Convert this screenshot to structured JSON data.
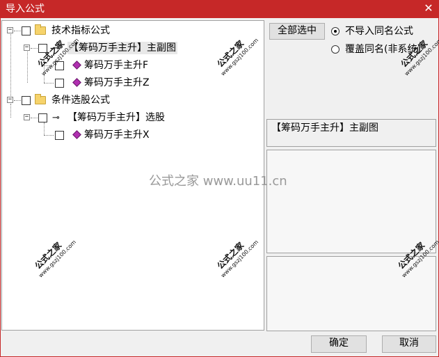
{
  "window": {
    "title": "导入公式",
    "close_glyph": "✕"
  },
  "tree": {
    "groups": [
      {
        "label": "技术指标公式",
        "expander": "−",
        "children": [
          {
            "label": "【筹码万手主升】主副图",
            "expander": "−",
            "children": [
              {
                "label": "筹码万手主升F"
              },
              {
                "label": "筹码万手主升Z"
              }
            ]
          }
        ]
      },
      {
        "label": "条件选股公式",
        "expander": "−",
        "children": [
          {
            "label": "【筹码万手主升】选股",
            "expander": "−",
            "children": [
              {
                "label": "筹码万手主升X"
              }
            ]
          }
        ]
      }
    ]
  },
  "options": {
    "select_all_label": "全部选中",
    "radio_skip_label": "不导入同名公式",
    "radio_overwrite_label": "覆盖同名(非系统)",
    "selected_radio": "skip"
  },
  "detail": {
    "name": "【筹码万手主升】主副图"
  },
  "buttons": {
    "ok_label": "确定",
    "cancel_label": "取消"
  },
  "watermark": {
    "brand": "公式之家",
    "url": "www.gszj100.com",
    "center_text": "公式之家 www.uu11.cn"
  }
}
